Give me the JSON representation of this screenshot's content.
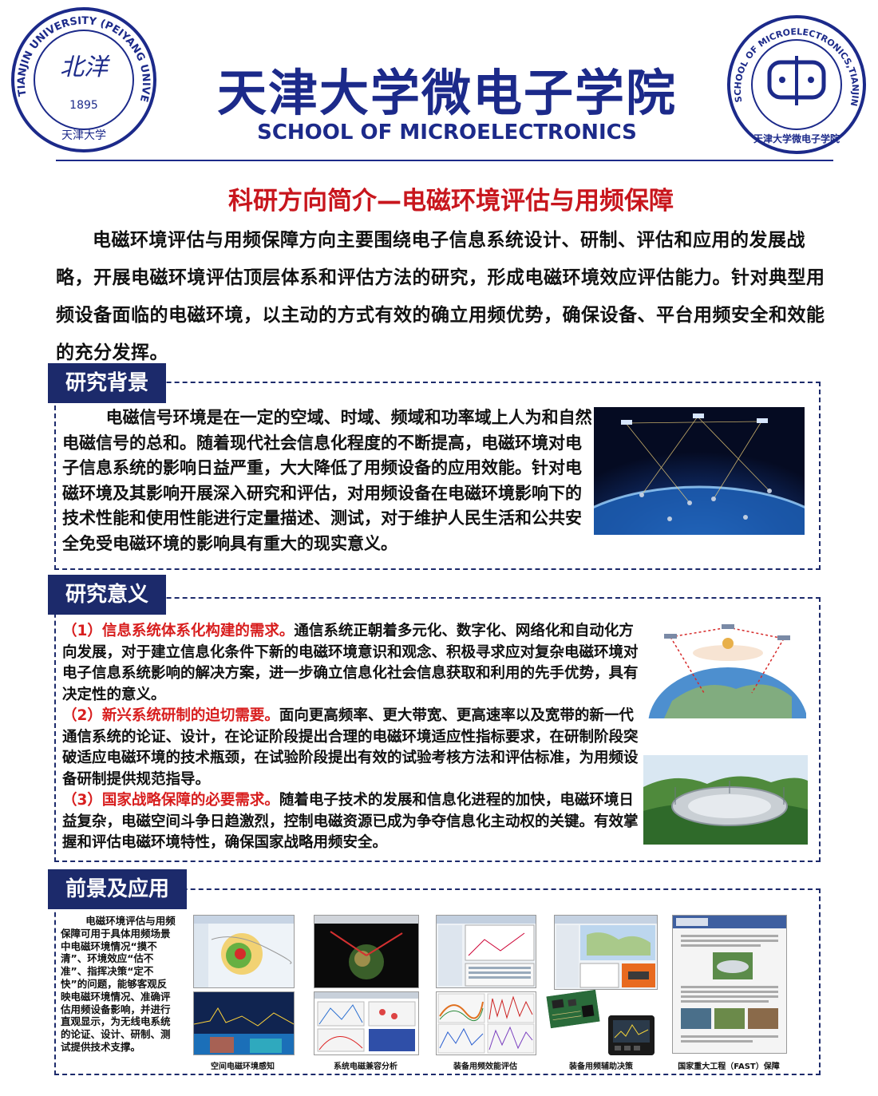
{
  "header": {
    "title_cn": "天津大学微电子学院",
    "title_en": "SCHOOL OF MICROELECTRONICS",
    "left_logo": {
      "ring_text": "TIANJIN UNIVERSITY (PEIYANG UNIVERSITY)",
      "year": "1895",
      "mark": "北洋",
      "footer": "天津大学",
      "color": "#1c2a8a"
    },
    "right_logo": {
      "ring_text": "SCHOOL OF MICROELECTRONICS,TIANJIN UNIVERSITY",
      "footer": "天津大学微电子学院",
      "color": "#1c2a8a"
    }
  },
  "subtitle": "科研方向简介—电磁环境评估与用频保障",
  "intro": "电磁环境评估与用频保障方向主要围绕电子信息系统设计、研制、评估和应用的发展战略，开展电磁环境评估顶层体系和评估方法的研究，形成电磁环境效应评估能力。针对典型用频设备面临的电磁环境，以主动的方式有效的确立用频优势，确保设备、平台用频安全和效能的充分发挥。",
  "background": {
    "heading": "研究背景",
    "text": "电磁信号环境是在一定的空域、时域、频域和功率域上人为和自然电磁信号的总和。随着现代社会信息化程度的不断提高，电磁环境对电子信息系统的影响日益严重，大大降低了用频设备的应用效能。针对电磁环境及其影响开展深入研究和评估，对用频设备在电磁环境影响下的技术性能和使用性能进行定量描述、测试，对于维护人民生活和公共安全免受电磁环境的影响具有重大的现实意义。"
  },
  "significance": {
    "heading": "研究意义",
    "items": [
      {
        "lead": "（1）信息系统体系化构建的需求。",
        "body": "通信系统正朝着多元化、数字化、网络化和自动化方向发展，对于建立信息化条件下新的电磁环境意识和观念、积极寻求应对复杂电磁环境对电子信息系统影响的解决方案，进一步确立信息化社会信息获取和利用的先手优势，具有决定性的意义。"
      },
      {
        "lead": "（2）新兴系统研制的迫切需要。",
        "body": "面向更高频率、更大带宽、更高速率以及宽带的新一代通信系统的论证、设计，在论证阶段提出合理的电磁环境适应性指标要求，在研制阶段突破适应电磁环境的技术瓶颈，在试验阶段提出有效的试验考核方法和评估标准，为用频设备研制提供规范指导。"
      },
      {
        "lead": "（3）国家战略保障的必要需求。",
        "body": "随着电子技术的发展和信息化进程的加快，电磁环境日益复杂，电磁空间斗争日趋激烈，控制电磁资源已成为争夺信息化主动权的关键。有效掌握和评估电磁环境特性，确保国家战略用频安全。"
      }
    ]
  },
  "prospects": {
    "heading": "前景及应用",
    "text": "电磁环境评估与用频保障可用于具体用频场景中电磁环境情况“摸不清”、环境效应“估不准”、指挥决策“定不快”的问题，能够客观反映电磁环境情况、准确评估用频设备影响，并进行直观显示，为无线电系统的论证、设计、研制、测试提供技术支撑。",
    "captions": [
      "空间电磁环境感知",
      "系统电磁兼容分析",
      "装备用频效能评估",
      "装备用频辅助决策",
      "国家重大工程（FAST）保障"
    ]
  },
  "colors": {
    "navy": "#1c2a6b",
    "brand_blue": "#1c2a8a",
    "accent_red": "#c8161d"
  }
}
